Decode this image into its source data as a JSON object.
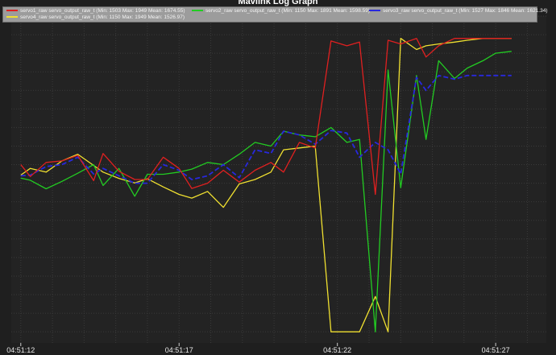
{
  "window": {
    "title": "Mavlink Log Graph"
  },
  "colors": {
    "background": "#1f1f1f",
    "plot_background": "#232323",
    "grid": "#3a3a3a",
    "axis_text": "#e8e8e8",
    "legend_background": "#9c9c9c"
  },
  "chart_data": {
    "type": "line",
    "title": "Mavlink Log Graph",
    "xlabel": "",
    "ylabel": "",
    "x_tick_labels": [
      "04:51:12",
      "04:51:17",
      "04:51:22",
      "04:51:27"
    ],
    "x_tick_values": [
      0,
      5,
      10,
      15
    ],
    "xlim": [
      -0.3,
      16.6
    ],
    "ylim": [
      1120,
      2000
    ],
    "grid": true,
    "legend_position": "top",
    "x": [
      0,
      0.3,
      0.8,
      1.3,
      1.8,
      2.3,
      2.6,
      3.1,
      3.6,
      4.0,
      4.5,
      5.0,
      5.4,
      5.9,
      6.4,
      6.9,
      7.4,
      7.9,
      8.3,
      8.8,
      9.3,
      9.8,
      10.3,
      10.7,
      11.2,
      11.6,
      12.0,
      12.5,
      12.8,
      13.2,
      13.7,
      14.1,
      14.6,
      15.0,
      15.5
    ],
    "series": [
      {
        "name": "servo1_raw servo_output_raw_t",
        "legend_label": "servo1_raw servo_output_raw_t (Min: 1503 Max: 1949 Mean: 1674.55)",
        "color": "#e02020",
        "values": [
          1600,
          1568,
          1606,
          1610,
          1625,
          1557,
          1630,
          1582,
          1560,
          1560,
          1620,
          1590,
          1536,
          1550,
          1585,
          1553,
          1585,
          1606,
          1580,
          1660,
          1645,
          1933,
          1920,
          1930,
          1520,
          1935,
          1925,
          1940,
          1890,
          1920,
          1940,
          1940,
          1940,
          1940,
          1940
        ]
      },
      {
        "name": "servo2_raw servo_output_raw_t",
        "legend_label": "servo2_raw servo_output_raw_t (Min: 1150 Max: 1891 Mean: 1598.59)",
        "color": "#22cc22",
        "values": [
          1564,
          1558,
          1535,
          1555,
          1577,
          1600,
          1544,
          1590,
          1515,
          1574,
          1574,
          1580,
          1588,
          1606,
          1600,
          1628,
          1660,
          1650,
          1690,
          1680,
          1675,
          1700,
          1660,
          1668,
          1150,
          1855,
          1538,
          1840,
          1668,
          1880,
          1832,
          1860,
          1880,
          1900,
          1905
        ]
      },
      {
        "name": "servo3_raw servo_output_raw_t",
        "legend_label": "servo3_raw servo_output_raw_t (Min: 1527 Max: 1846 Mean: 1621.34)",
        "color": "#2828dd",
        "values": [
          1570,
          1572,
          1595,
          1600,
          1620,
          1575,
          1590,
          1570,
          1550,
          1550,
          1600,
          1585,
          1560,
          1570,
          1600,
          1565,
          1640,
          1630,
          1690,
          1680,
          1655,
          1692,
          1685,
          1620,
          1660,
          1640,
          1575,
          1835,
          1800,
          1840,
          1830,
          1840,
          1840,
          1840,
          1840
        ]
      },
      {
        "name": "servo4_raw servo_output_raw_t",
        "legend_label": "servo4_raw servo_output_raw_t (Min: 1150 Max: 1949 Mean: 1526.97)",
        "color": "#f0e030",
        "values": [
          1572,
          1590,
          1580,
          1610,
          1628,
          1598,
          1580,
          1563,
          1551,
          1562,
          1540,
          1520,
          1510,
          1528,
          1485,
          1548,
          1560,
          1580,
          1640,
          1645,
          1650,
          1150,
          1150,
          1150,
          1245,
          1150,
          1940,
          1910,
          1920,
          1925,
          1930,
          1935,
          1940,
          1940,
          1940
        ]
      }
    ]
  }
}
